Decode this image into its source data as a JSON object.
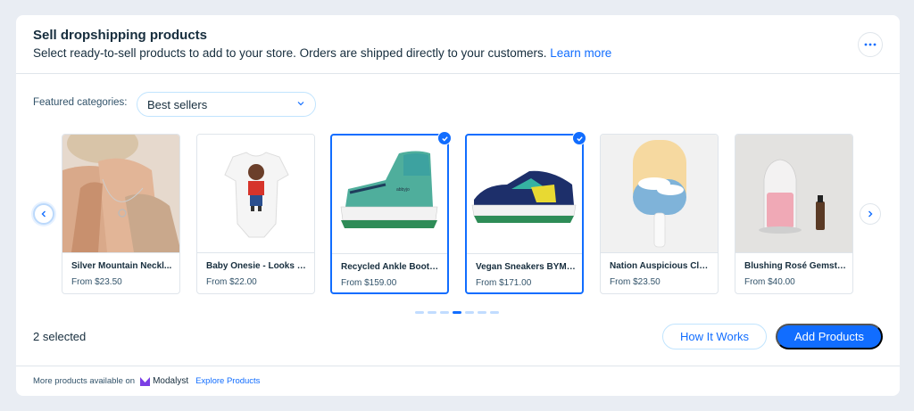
{
  "header": {
    "title": "Sell dropshipping products",
    "subtitle": "Select ready-to-sell products to add to your store. Orders are shipped directly to your customers.",
    "learn_more": "Learn more",
    "more_icon": "ellipsis-icon"
  },
  "filters": {
    "label": "Featured categories:",
    "selected": "Best sellers"
  },
  "products": [
    {
      "name": "Silver Mountain Neckl...",
      "price": "From $23.50",
      "selected": false
    },
    {
      "name": "Baby Onesie - Looks Li...",
      "price": "From $22.00",
      "selected": false
    },
    {
      "name": "Recycled Ankle Boots ...",
      "price": "From $159.00",
      "selected": true
    },
    {
      "name": "Vegan Sneakers BYMA...",
      "price": "From $171.00",
      "selected": true
    },
    {
      "name": "Nation Auspicious Clo...",
      "price": "From $23.50",
      "selected": false
    },
    {
      "name": "Blushing Rosé Gemsto...",
      "price": "From $40.00",
      "selected": false
    }
  ],
  "pagination": {
    "pages": 7,
    "current": 4
  },
  "footer_actions": {
    "selected_count": "2 selected",
    "how_it_works": "How It Works",
    "add_products": "Add Products"
  },
  "footer": {
    "text": "More products available on",
    "brand": "Modalyst",
    "explore": "Explore Products"
  },
  "colors": {
    "accent": "#116dff",
    "text": "#162d3d",
    "border": "#dfe5eb",
    "background": "#e9edf3"
  }
}
